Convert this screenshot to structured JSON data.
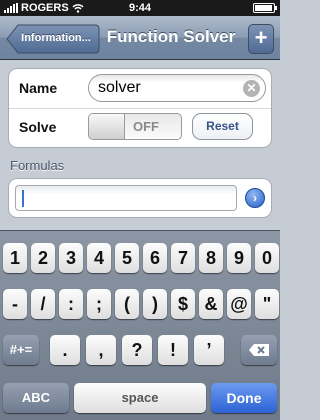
{
  "status_bar": {
    "carrier": "ROGERS",
    "time": "9:44"
  },
  "nav": {
    "back_label": "Information...",
    "title": "Function Solver",
    "add_label": "+"
  },
  "form": {
    "name_label": "Name",
    "name_value": "solver",
    "solve_label": "Solve",
    "toggle_state": "OFF",
    "reset_label": "Reset"
  },
  "formulas": {
    "section_label": "Formulas",
    "input_value": ""
  },
  "keyboard": {
    "row1": [
      "1",
      "2",
      "3",
      "4",
      "5",
      "6",
      "7",
      "8",
      "9",
      "0"
    ],
    "row2": [
      "-",
      "/",
      ":",
      ";",
      "(",
      ")",
      "$",
      "&",
      "@",
      "\""
    ],
    "row3": [
      ".",
      ",",
      "?",
      "!",
      "’"
    ],
    "mode_key": "#+=",
    "delete_icon": "backspace-icon",
    "abc_key": "ABC",
    "space_key": "space",
    "done_key": "Done"
  },
  "colors": {
    "nav_bar": "#7589a3",
    "done_key": "#2d63d4",
    "page_bg": "#c5ccd4"
  }
}
